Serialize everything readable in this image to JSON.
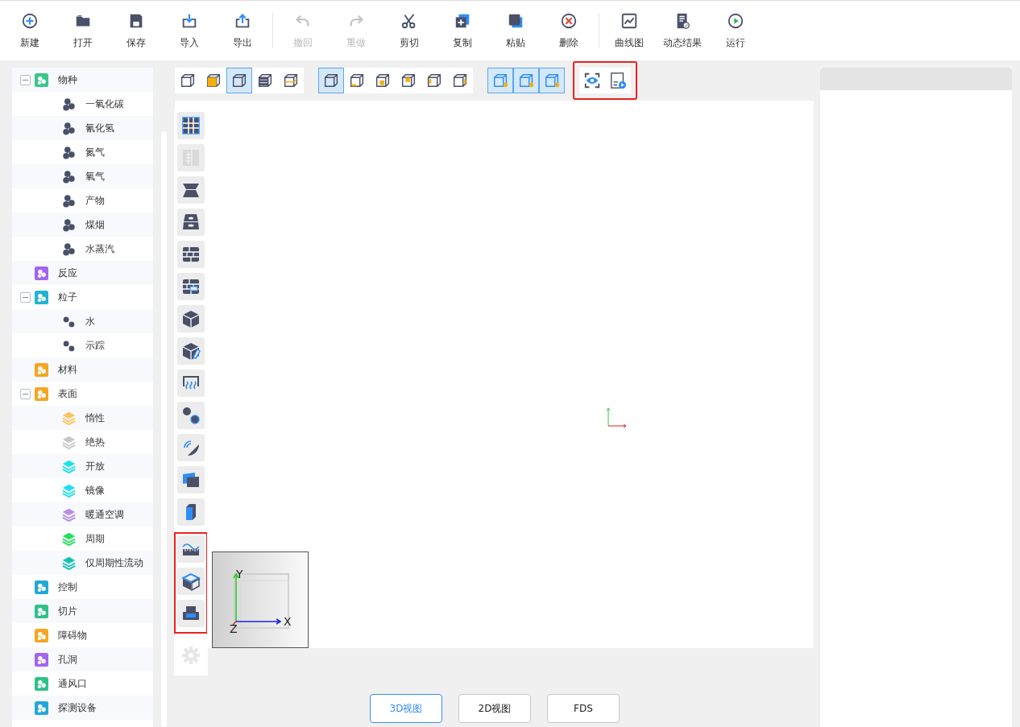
{
  "toolbar": {
    "groups": [
      [
        {
          "label": "新建",
          "disabled": false
        },
        {
          "label": "打开",
          "disabled": false
        },
        {
          "label": "保存",
          "disabled": false
        },
        {
          "label": "导入",
          "disabled": false
        },
        {
          "label": "导出",
          "disabled": false
        }
      ],
      [
        {
          "label": "撤回",
          "disabled": true
        },
        {
          "label": "重做",
          "disabled": true
        },
        {
          "label": "剪切",
          "disabled": false
        },
        {
          "label": "复制",
          "disabled": false
        },
        {
          "label": "粘贴",
          "disabled": false
        },
        {
          "label": "删除",
          "disabled": false
        }
      ],
      [
        {
          "label": "曲线图",
          "disabled": false
        },
        {
          "label": "动态结果",
          "disabled": false
        },
        {
          "label": "运行",
          "disabled": false
        }
      ]
    ]
  },
  "tree": [
    {
      "label": "物种",
      "kind": "tile",
      "color": "#3cc68a",
      "expanded": true,
      "children": [
        {
          "label": "一氧化碳",
          "kind": "molecule",
          "color": "#4a5068"
        },
        {
          "label": "氰化氢",
          "kind": "molecule",
          "color": "#4a5068"
        },
        {
          "label": "氮气",
          "kind": "molecule",
          "color": "#4a5068"
        },
        {
          "label": "氧气",
          "kind": "molecule",
          "color": "#4a5068"
        },
        {
          "label": "产物",
          "kind": "molecule",
          "color": "#4a5068"
        },
        {
          "label": "煤烟",
          "kind": "molecule",
          "color": "#4a5068"
        },
        {
          "label": "水蒸汽",
          "kind": "molecule",
          "color": "#4a5068"
        }
      ]
    },
    {
      "label": "反应",
      "kind": "tile",
      "color": "#a463f2"
    },
    {
      "label": "粒子",
      "kind": "tile",
      "color": "#22b3d6",
      "expanded": true,
      "children": [
        {
          "label": "水",
          "kind": "pair",
          "color": "#4a5068"
        },
        {
          "label": "示踪",
          "kind": "pair",
          "color": "#4a5068"
        }
      ]
    },
    {
      "label": "材料",
      "kind": "tile",
      "color": "#f5a623"
    },
    {
      "label": "表面",
      "kind": "tile",
      "color": "#f5a623",
      "expanded": true,
      "children": [
        {
          "label": "惰性",
          "kind": "layers",
          "color": "#fcc45a"
        },
        {
          "label": "绝热",
          "kind": "layers",
          "color": "#c8c8c8"
        },
        {
          "label": "开放",
          "kind": "layers",
          "color": "#1de0f0"
        },
        {
          "label": "镜像",
          "kind": "layers",
          "color": "#1de0f0"
        },
        {
          "label": "暖通空调",
          "kind": "layers",
          "color": "#b88ee8"
        },
        {
          "label": "周期",
          "kind": "layers",
          "color": "#22e05a"
        },
        {
          "label": "仅周期性流动",
          "kind": "layers",
          "color": "#12c2b8"
        }
      ]
    },
    {
      "label": "控制",
      "kind": "tile",
      "color": "#22a8d8"
    },
    {
      "label": "切片",
      "kind": "tile",
      "color": "#2ec28a"
    },
    {
      "label": "障碍物",
      "kind": "tile",
      "color": "#f5a623"
    },
    {
      "label": "孔洞",
      "kind": "tile",
      "color": "#a463f2"
    },
    {
      "label": "通风口",
      "kind": "tile",
      "color": "#2ec28a"
    },
    {
      "label": "探测设备",
      "kind": "tile",
      "color": "#22a8d8"
    }
  ],
  "view_toolbar": {
    "groups": [
      {
        "highlighted": false,
        "buttons": [
          {
            "selected": false
          },
          {
            "selected": false
          },
          {
            "selected": true
          },
          {
            "selected": false
          },
          {
            "selected": false
          }
        ]
      },
      {
        "highlighted": false,
        "buttons": [
          {
            "selected": true
          },
          {
            "selected": false
          },
          {
            "selected": false
          },
          {
            "selected": false
          },
          {
            "selected": false
          },
          {
            "selected": false
          }
        ]
      },
      {
        "highlighted": false,
        "buttons": [
          {
            "selected": true
          },
          {
            "selected": true
          },
          {
            "selected": true
          }
        ]
      },
      {
        "highlighted": true,
        "buttons": [
          {
            "selected": false
          },
          {
            "selected": false
          }
        ]
      }
    ]
  },
  "side_tools": {
    "groups": [
      {
        "highlighted": false,
        "tools": [
          {
            "disabled": false
          },
          {
            "disabled": true
          },
          {
            "disabled": false
          },
          {
            "disabled": false
          },
          {
            "disabled": false
          },
          {
            "disabled": false
          },
          {
            "disabled": false
          },
          {
            "disabled": false
          },
          {
            "disabled": false
          },
          {
            "disabled": false
          },
          {
            "disabled": false
          },
          {
            "disabled": false
          },
          {
            "disabled": false
          }
        ]
      },
      {
        "highlighted": true,
        "tools": [
          {
            "disabled": false
          },
          {
            "disabled": false
          },
          {
            "disabled": false
          }
        ]
      },
      {
        "highlighted": false,
        "tools": [
          {
            "disabled": true
          }
        ]
      }
    ]
  },
  "nav_cube": {
    "axes": [
      "X",
      "Y",
      "Z"
    ]
  },
  "view_tabs": [
    {
      "label": "3D视图",
      "selected": true
    },
    {
      "label": "2D视图",
      "selected": false
    },
    {
      "label": "FDS",
      "selected": false
    }
  ]
}
